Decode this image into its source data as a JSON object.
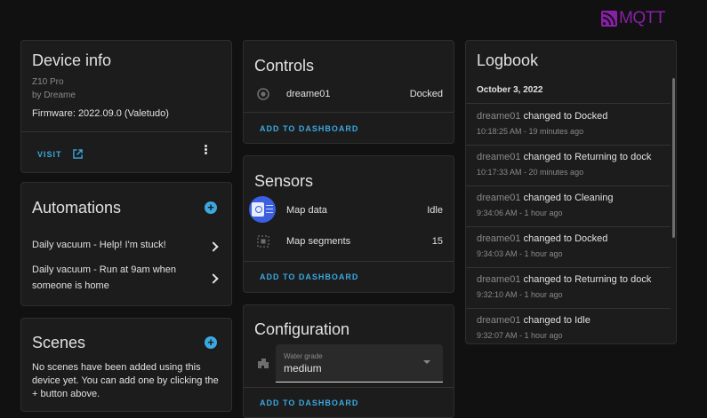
{
  "brand": {
    "logo_text": "MQTT",
    "color": "#8a1fa8"
  },
  "device_info": {
    "title": "Device info",
    "model": "Z10 Pro",
    "manufacturer": "by Dreame",
    "firmware": "Firmware: 2022.09.0 (Valetudo)",
    "visit_label": "VISIT"
  },
  "automations": {
    "title": "Automations",
    "items": [
      {
        "label": "Daily vacuum - Help! I'm stuck!"
      },
      {
        "label_line1": "Daily vacuum - Run at 9am when",
        "label_line2": "someone is home"
      }
    ]
  },
  "scenes": {
    "title": "Scenes",
    "empty_line1": "No scenes have been added using this",
    "empty_line2": "device yet. You can add one by clicking the",
    "empty_line3": "+ button above."
  },
  "controls": {
    "title": "Controls",
    "entity_name": "dreame01",
    "entity_state": "Docked",
    "add_label": "ADD TO DASHBOARD"
  },
  "sensors": {
    "title": "Sensors",
    "items": [
      {
        "name": "Map data",
        "value": "Idle"
      },
      {
        "name": "Map segments",
        "value": "15"
      }
    ],
    "add_label": "ADD TO DASHBOARD"
  },
  "configuration": {
    "title": "Configuration",
    "select_label": "Water grade",
    "select_value": "medium",
    "add_label": "ADD TO DASHBOARD"
  },
  "logbook": {
    "title": "Logbook",
    "date": "October 3, 2022",
    "entries": [
      {
        "entity": "dreame01",
        "message": "changed to Docked",
        "time": "10:18:25 AM - 19 minutes ago"
      },
      {
        "entity": "dreame01",
        "message": "changed to Returning to dock",
        "time": "10:17:33 AM - 20 minutes ago"
      },
      {
        "entity": "dreame01",
        "message": "changed to Cleaning",
        "time": "9:34:06 AM - 1 hour ago"
      },
      {
        "entity": "dreame01",
        "message": "changed to Docked",
        "time": "9:34:03 AM - 1 hour ago"
      },
      {
        "entity": "dreame01",
        "message": "changed to Returning to dock",
        "time": "9:32:10 AM - 1 hour ago"
      },
      {
        "entity": "dreame01",
        "message": "changed to Idle",
        "time": "9:32:07 AM - 1 hour ago"
      }
    ]
  }
}
